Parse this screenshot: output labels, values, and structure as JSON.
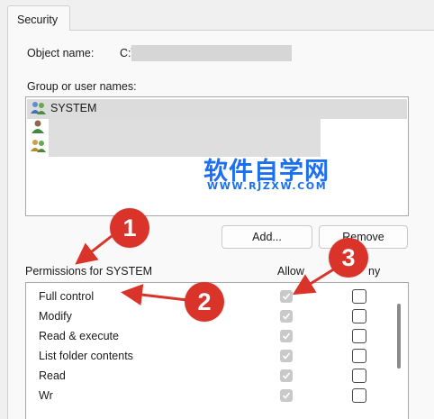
{
  "tab": {
    "label": "Security"
  },
  "object": {
    "label": "Object name:",
    "value": "C:\\"
  },
  "group": {
    "label": "Group or user names:",
    "users": [
      {
        "name": "SYSTEM"
      },
      {
        "name": ""
      },
      {
        "name": ""
      }
    ]
  },
  "buttons": {
    "add": "Add...",
    "remove": "Remove"
  },
  "permissions": {
    "label": "Permissions for SYSTEM",
    "allow_header": "Allow",
    "deny_header": "ny",
    "rows": [
      {
        "name": "Full control",
        "allow": true,
        "deny": false
      },
      {
        "name": "Modify",
        "allow": true,
        "deny": false
      },
      {
        "name": "Read & execute",
        "allow": true,
        "deny": false
      },
      {
        "name": "List folder contents",
        "allow": true,
        "deny": false
      },
      {
        "name": "Read",
        "allow": true,
        "deny": false
      },
      {
        "name": "Wr",
        "allow": true,
        "deny": false
      }
    ]
  },
  "annotations": [
    "1",
    "2",
    "3"
  ],
  "watermark": {
    "title": "软件自学网",
    "url": "WWW.RJZXW.COM"
  },
  "colors": {
    "annotation": "#d9332a",
    "watermark": "#1d6ff0",
    "checkbox_disabled": "#c9c9c9"
  }
}
